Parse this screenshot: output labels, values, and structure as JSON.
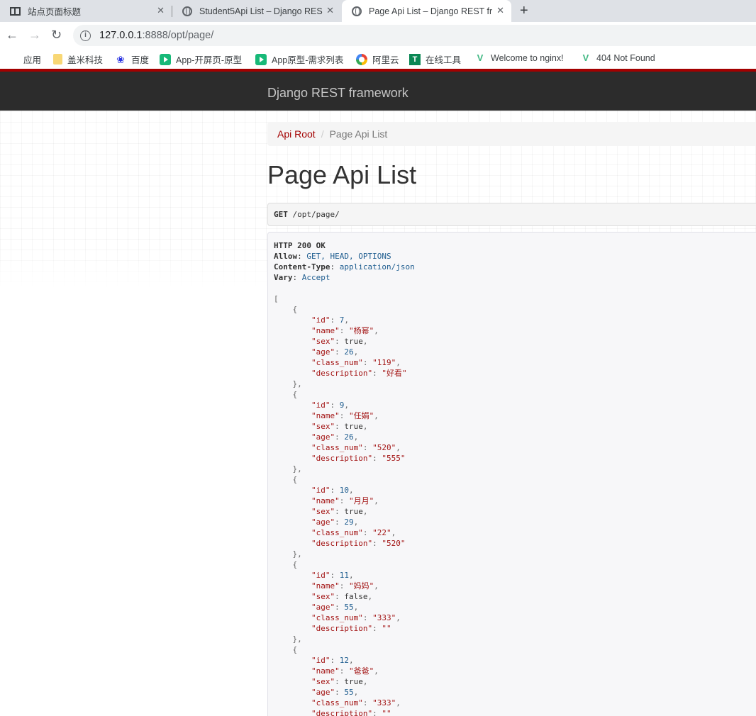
{
  "browser": {
    "tabs": [
      {
        "title": "站点页面标题",
        "icon": "reader-icon",
        "active": false
      },
      {
        "title": "Student5Api List – Django RES",
        "icon": "globe-icon",
        "active": false
      },
      {
        "title": "Page Api List – Django REST fr",
        "icon": "globe-icon",
        "active": true
      }
    ],
    "new_tab": "+",
    "close_glyph": "✕",
    "url": {
      "host": "127.0.0.1",
      "path": ":8888/opt/page/"
    },
    "bookmarks": [
      {
        "label": "应用",
        "icon": "apps-grid-icon"
      },
      {
        "label": "盖米科技",
        "icon": "folder-icon"
      },
      {
        "label": "百度",
        "icon": "baidu-paw-icon"
      },
      {
        "label": "App-开屏页-原型",
        "icon": "axure-play-icon"
      },
      {
        "label": "App原型-需求列表",
        "icon": "axure-play-icon"
      },
      {
        "label": "阿里云",
        "icon": "aliyun-icon"
      },
      {
        "label": "在线工具",
        "icon": "tool-icon"
      },
      {
        "label": "Welcome to nginx!",
        "icon": "vue-icon"
      },
      {
        "label": "404 Not Found",
        "icon": "vue-icon"
      }
    ]
  },
  "drf": {
    "brand": "Django REST framework",
    "breadcrumb": {
      "root": "Api Root",
      "separator": "/",
      "current": "Page Api List"
    },
    "title": "Page Api List",
    "request": {
      "method": "GET",
      "path": "/opt/page/"
    },
    "response": {
      "status": "HTTP 200 OK",
      "headers": [
        {
          "key": "Allow",
          "value": "GET, HEAD, OPTIONS"
        },
        {
          "key": "Content-Type",
          "value": "application/json"
        },
        {
          "key": "Vary",
          "value": "Accept"
        }
      ],
      "items": [
        {
          "id": 7,
          "name": "杨幂",
          "sex": true,
          "age": 26,
          "class_num": "119",
          "description": "好看"
        },
        {
          "id": 9,
          "name": "任娟",
          "sex": true,
          "age": 26,
          "class_num": "520",
          "description": "555"
        },
        {
          "id": 10,
          "name": "月月",
          "sex": true,
          "age": 29,
          "class_num": "22",
          "description": "520"
        },
        {
          "id": 11,
          "name": "妈妈",
          "sex": false,
          "age": 55,
          "class_num": "333",
          "description": ""
        },
        {
          "id": 12,
          "name": "爸爸",
          "sex": true,
          "age": 55,
          "class_num": "333",
          "description": ""
        }
      ]
    }
  },
  "colors": {
    "drf_red": "#a30000",
    "navbar_bg": "#2c2c2c",
    "link_value": "#1d5c8f",
    "json_string": "#a31515"
  }
}
